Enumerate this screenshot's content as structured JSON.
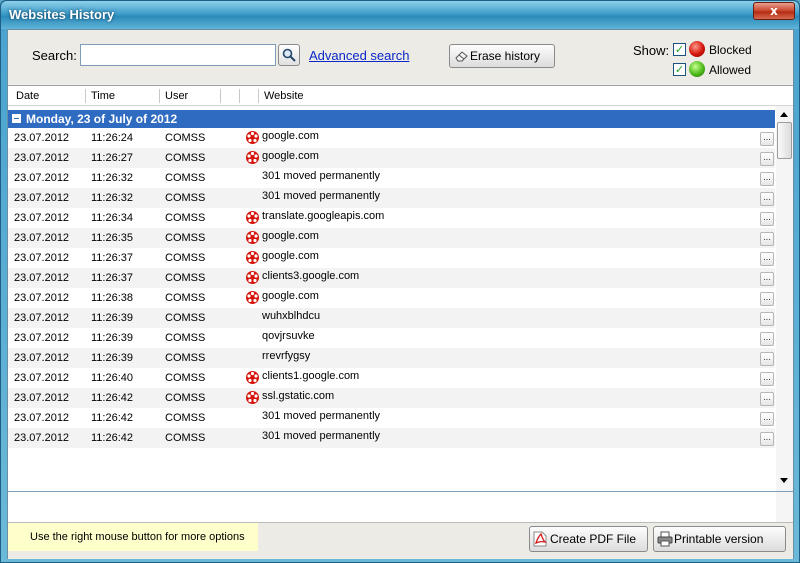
{
  "window": {
    "title": "Websites History",
    "close_glyph": "x"
  },
  "toolbar": {
    "search_label": "Search:",
    "search_value": "",
    "search_icon": "magnifier-icon",
    "advanced_search": "Advanced search",
    "erase_history": "Erase history",
    "show_label": "Show:",
    "blocked_label": "Blocked",
    "allowed_label": "Allowed",
    "blocked_checked": true,
    "allowed_checked": true,
    "blocked_color": "#d5140a",
    "allowed_color": "#4db81a"
  },
  "grid": {
    "columns": [
      "Date",
      "Time",
      "User",
      "",
      "",
      "Website"
    ],
    "group_label": "Monday, 23 of July of 2012",
    "group_color": "#2f6cc1",
    "more_label": "...",
    "rows": [
      {
        "date": "23.07.2012",
        "time": "11:26:24",
        "user": "COMSS",
        "website": "google.com",
        "blocked": true
      },
      {
        "date": "23.07.2012",
        "time": "11:26:27",
        "user": "COMSS",
        "website": "google.com",
        "blocked": true
      },
      {
        "date": "23.07.2012",
        "time": "11:26:32",
        "user": "COMSS",
        "website": "301 moved permanently",
        "blocked": false
      },
      {
        "date": "23.07.2012",
        "time": "11:26:32",
        "user": "COMSS",
        "website": "301 moved permanently",
        "blocked": false
      },
      {
        "date": "23.07.2012",
        "time": "11:26:34",
        "user": "COMSS",
        "website": "translate.googleapis.com",
        "blocked": true
      },
      {
        "date": "23.07.2012",
        "time": "11:26:35",
        "user": "COMSS",
        "website": "google.com",
        "blocked": true
      },
      {
        "date": "23.07.2012",
        "time": "11:26:37",
        "user": "COMSS",
        "website": "google.com",
        "blocked": true
      },
      {
        "date": "23.07.2012",
        "time": "11:26:37",
        "user": "COMSS",
        "website": "clients3.google.com",
        "blocked": true
      },
      {
        "date": "23.07.2012",
        "time": "11:26:38",
        "user": "COMSS",
        "website": "google.com",
        "blocked": true
      },
      {
        "date": "23.07.2012",
        "time": "11:26:39",
        "user": "COMSS",
        "website": "wuhxblhdcu",
        "blocked": false
      },
      {
        "date": "23.07.2012",
        "time": "11:26:39",
        "user": "COMSS",
        "website": "qovjrsuvke",
        "blocked": false
      },
      {
        "date": "23.07.2012",
        "time": "11:26:39",
        "user": "COMSS",
        "website": "rrevrfygsy",
        "blocked": false
      },
      {
        "date": "23.07.2012",
        "time": "11:26:40",
        "user": "COMSS",
        "website": "clients1.google.com",
        "blocked": true
      },
      {
        "date": "23.07.2012",
        "time": "11:26:42",
        "user": "COMSS",
        "website": "ssl.gstatic.com",
        "blocked": true
      },
      {
        "date": "23.07.2012",
        "time": "11:26:42",
        "user": "COMSS",
        "website": "301 moved permanently",
        "blocked": false
      },
      {
        "date": "23.07.2012",
        "time": "11:26:42",
        "user": "COMSS",
        "website": "301 moved permanently",
        "blocked": false
      }
    ]
  },
  "footer": {
    "hint": "Use the right mouse button for more options",
    "create_pdf": "Create PDF File",
    "printable": "Printable version"
  }
}
